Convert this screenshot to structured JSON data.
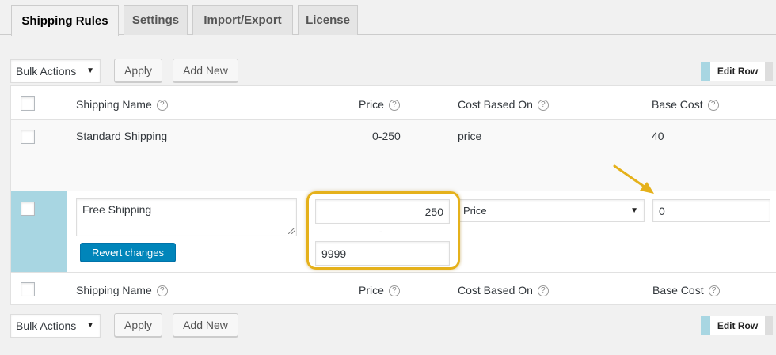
{
  "tabs": [
    {
      "label": "Shipping Rules",
      "active": true
    },
    {
      "label": "Settings",
      "active": false
    },
    {
      "label": "Import/Export",
      "active": false
    },
    {
      "label": "License",
      "active": false
    }
  ],
  "toolbar_top": {
    "bulk_actions": "Bulk Actions",
    "apply": "Apply",
    "add_new": "Add New",
    "edit_row": "Edit Row"
  },
  "toolbar_bottom": {
    "bulk_actions": "Bulk Actions",
    "apply": "Apply",
    "add_new": "Add New",
    "edit_row": "Edit Row"
  },
  "columns": {
    "shipping_name": "Shipping Name",
    "price": "Price",
    "cost_based_on": "Cost Based On",
    "base_cost": "Base Cost",
    "help_glyph": "?"
  },
  "rows": [
    {
      "shipping_name": "Standard Shipping",
      "price": "0-250",
      "cost_based_on": "price",
      "base_cost": "40"
    }
  ],
  "edit_row": {
    "shipping_name": "Free Shipping",
    "revert_label": "Revert changes",
    "price_min": "250",
    "price_separator": "-",
    "price_max": "9999",
    "cost_based_on": "Price",
    "base_cost": "0"
  },
  "colors": {
    "edit_row_accent": "#a8d6e2",
    "primary_button": "#0085ba",
    "highlight": "#e5b11b"
  }
}
